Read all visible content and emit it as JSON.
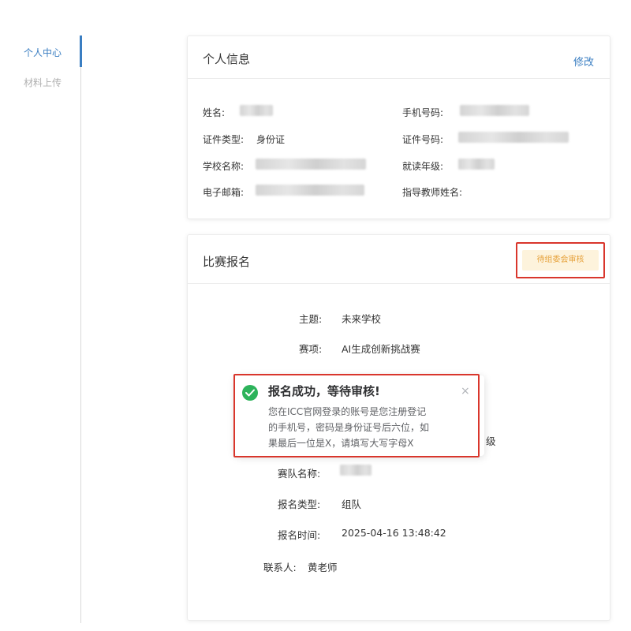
{
  "sidebar": {
    "items": [
      {
        "label": "个人中心",
        "active": true
      },
      {
        "label": "材料上传",
        "active": false
      }
    ]
  },
  "personal_info": {
    "title": "个人信息",
    "edit_label": "修改",
    "fields": {
      "name": {
        "label": "姓名:",
        "value_blurred": true
      },
      "phone": {
        "label": "手机号码:",
        "value_blurred": true
      },
      "id_type": {
        "label": "证件类型:",
        "value": "身份证"
      },
      "id_number": {
        "label": "证件号码:",
        "value_blurred": true
      },
      "school": {
        "label": "学校名称:",
        "value_blurred": true
      },
      "grade": {
        "label": "就读年级:",
        "value_blurred": true
      },
      "email": {
        "label": "电子邮箱:",
        "value_blurred": true
      },
      "advisor": {
        "label": "指导教师姓名:",
        "value": ""
      }
    }
  },
  "registration": {
    "title": "比赛报名",
    "status_badge": "待组委会审核",
    "rows": {
      "theme": {
        "label": "主题:",
        "value": "未来学校"
      },
      "event": {
        "label": "赛项:",
        "value": "AI生成创新挑战赛"
      },
      "grade_suffix": "级",
      "team_name": {
        "label": "赛队名称:",
        "value_blurred": true
      },
      "reg_type": {
        "label": "报名类型:",
        "value": "组队"
      },
      "reg_time": {
        "label": "报名时间:",
        "value": "2025-04-16 13:48:42"
      },
      "contact": {
        "label": "联系人:",
        "value": "黄老师"
      }
    }
  },
  "toast": {
    "title": "报名成功，等待审核!",
    "message_lines": [
      "您在ICC官网登录的账号是您注册登记",
      "的手机号，密码是身份证号后六位，如",
      "果最后一位是X，请填写大写字母X"
    ],
    "close_glyph": "×",
    "icon": "check-circle-icon"
  },
  "colors": {
    "accent": "#3a7ec2",
    "success": "#2db35b",
    "warning_text": "#e6a23c",
    "warning_bg": "#fdf3dc",
    "highlight_outline": "#d9362c"
  }
}
